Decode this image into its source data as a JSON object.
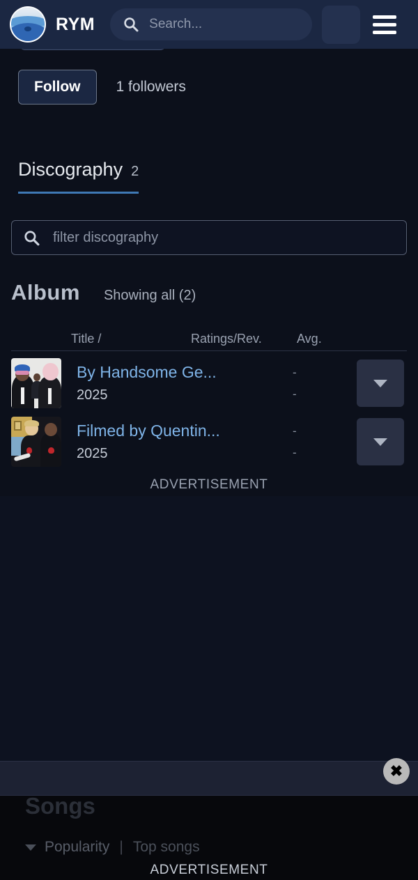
{
  "header": {
    "brand": "RYM",
    "logo_icon": "rym-wave-logo-icon",
    "search_placeholder": "Search...",
    "search_value": "",
    "search_icon": "search-icon",
    "square_button_label": "",
    "menu_icon": "hamburger-menu-icon"
  },
  "profile": {
    "follow_label": "Follow",
    "followers_text": "1 followers"
  },
  "tabs": {
    "discography": {
      "label": "Discography",
      "count": "2"
    }
  },
  "filter": {
    "placeholder": "filter discography",
    "value": "",
    "icon": "search-icon"
  },
  "discography": {
    "section_title": "Album",
    "showing_text": "Showing all (2)",
    "columns": {
      "title": "Title  /",
      "ratings": "Ratings/Rev.",
      "avg": "Avg."
    },
    "rows": [
      {
        "title": "By Handsome Ge...",
        "year": "2025",
        "ratings": "-",
        "avg": "-",
        "cover_icon": "album-cover-art",
        "dropdown_icon": "chevron-down-icon"
      },
      {
        "title": "Filmed by Quentin...",
        "year": "2025",
        "ratings": "-",
        "avg": "-",
        "cover_icon": "album-cover-art",
        "dropdown_icon": "chevron-down-icon"
      }
    ]
  },
  "ads": {
    "top_label": "ADVERTISEMENT",
    "bottom_label": "ADVERTISEMENT",
    "close_icon": "close-icon",
    "close_glyph": "✖"
  },
  "songs_section": {
    "title": "Songs",
    "sort_label": "Popularity",
    "separator": "|",
    "link_label": "Top songs",
    "sort_icon": "triangle-down-icon"
  },
  "colors": {
    "header_bg": "#1b2742",
    "page_bg": "#0c101b",
    "accent_link": "#7fb4e8",
    "tab_underline": "#3f79b5"
  }
}
